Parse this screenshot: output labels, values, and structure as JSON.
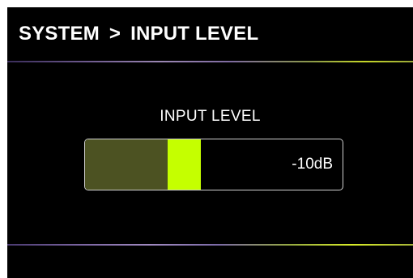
{
  "header": {
    "breadcrumb": [
      "SYSTEM",
      "INPUT LEVEL"
    ],
    "separator": ">"
  },
  "main": {
    "title": "INPUT LEVEL",
    "meter": {
      "value_label": "-10dB",
      "level_fraction": 0.32,
      "peak_start_fraction": 0.32,
      "peak_end_fraction": 0.45
    }
  },
  "colors": {
    "background": "#000000",
    "text": "#ffffff",
    "meter_fill": "#4c5222",
    "meter_peak": "#c5ff00",
    "meter_border": "#cfcfcf"
  }
}
